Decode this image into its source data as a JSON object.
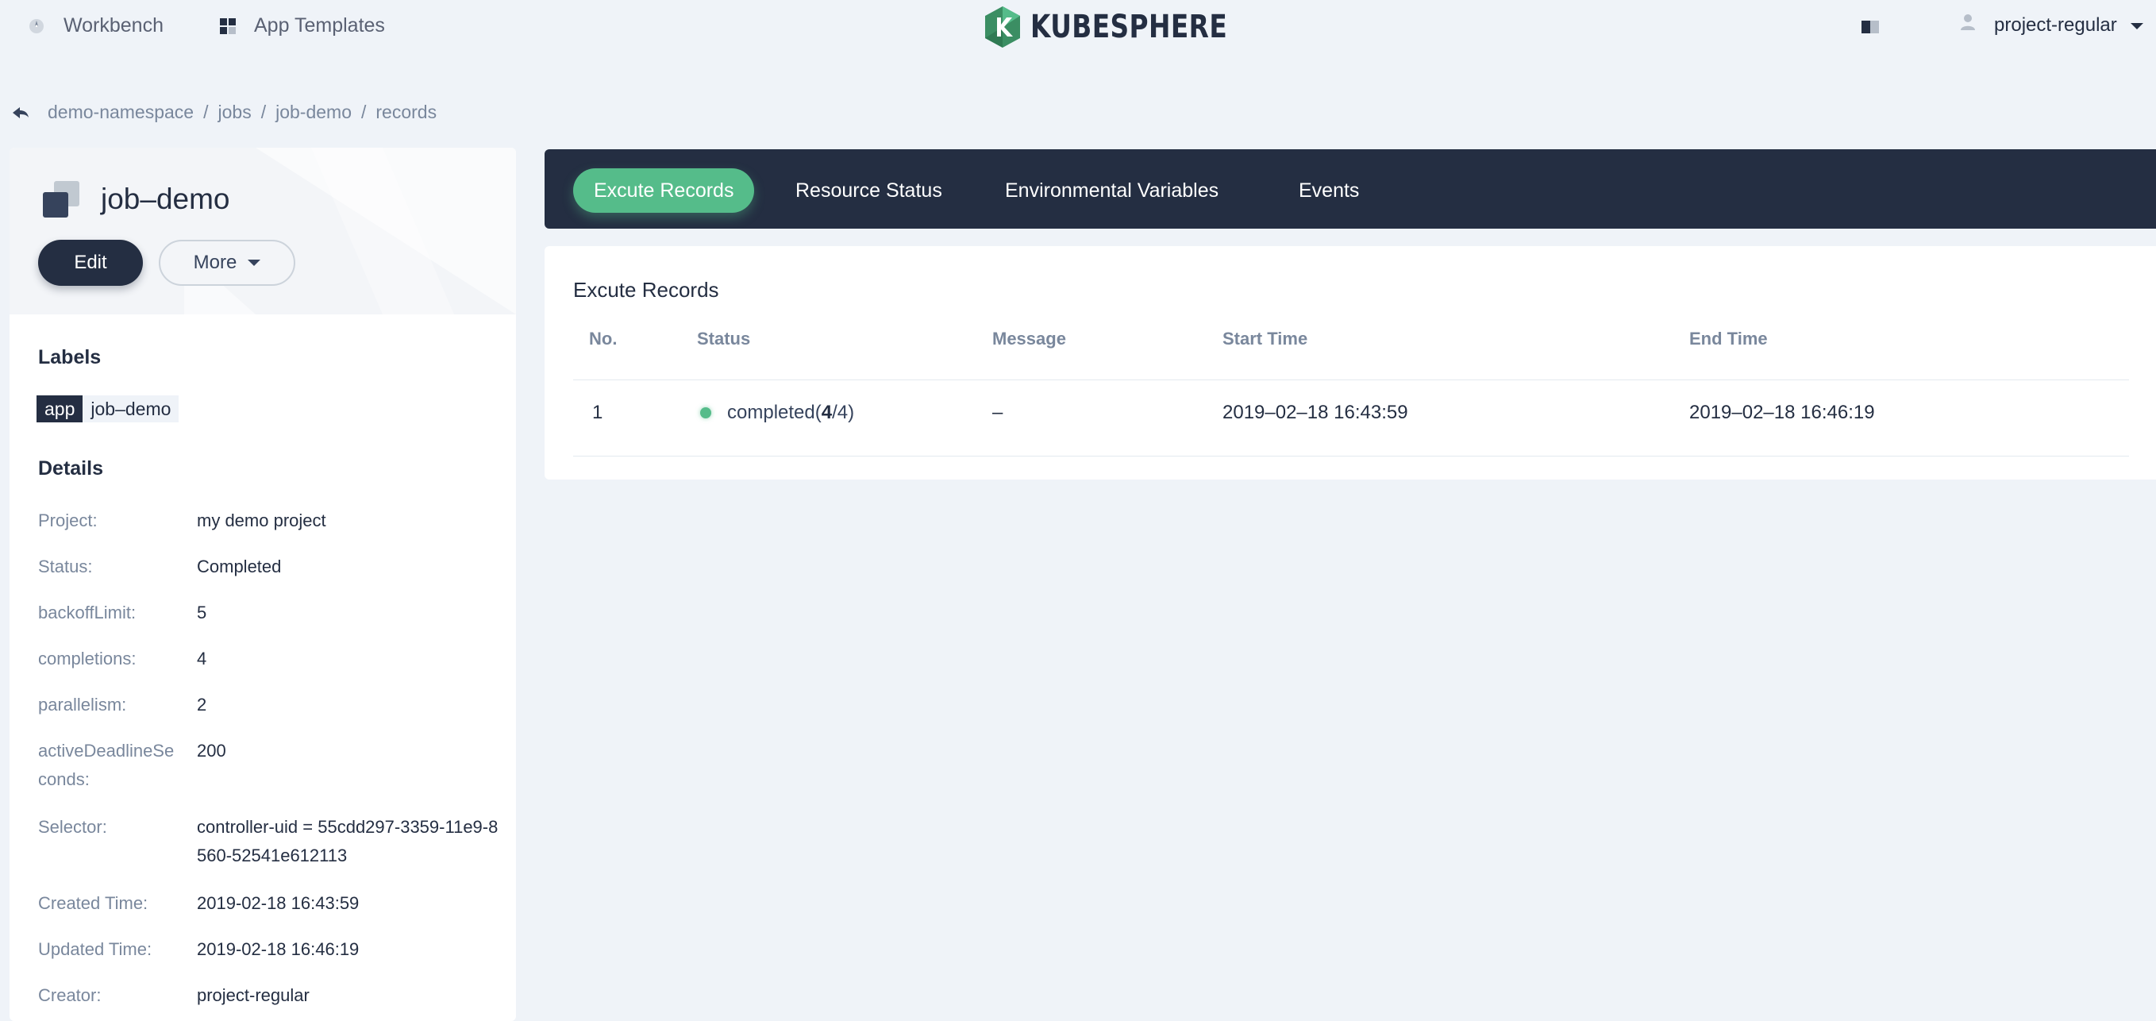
{
  "topbar": {
    "workbench": "Workbench",
    "app_templates": "App Templates",
    "logo": "KUBESPHERE",
    "user": "project-regular"
  },
  "breadcrumb": [
    "demo-namespace",
    "jobs",
    "job-demo",
    "records"
  ],
  "job": {
    "name": "job–demo",
    "edit_label": "Edit",
    "more_label": "More"
  },
  "labels": {
    "title": "Labels",
    "items": [
      {
        "key": "app",
        "value": "job–demo"
      }
    ]
  },
  "details": {
    "title": "Details",
    "rows": [
      {
        "key": "Project:",
        "value": "my demo project"
      },
      {
        "key": "Status:",
        "value": "Completed"
      },
      {
        "key": "backoffLimit:",
        "value": "5"
      },
      {
        "key": "completions:",
        "value": "4"
      },
      {
        "key": "parallelism:",
        "value": "2"
      },
      {
        "key": "activeDeadlineSeconds:",
        "value": "200"
      },
      {
        "key": "Selector:",
        "value": "controller-uid = 55cdd297-3359-11e9-8560-52541e612113"
      },
      {
        "key": "Created Time:",
        "value": "2019-02-18 16:43:59"
      },
      {
        "key": "Updated Time:",
        "value": "2019-02-18 16:46:19"
      },
      {
        "key": "Creator:",
        "value": "project-regular"
      }
    ]
  },
  "tabs": [
    "Excute Records",
    "Resource Status",
    "Environmental Variables",
    "Events"
  ],
  "records": {
    "title": "Excute Records",
    "columns": [
      "No.",
      "Status",
      "Message",
      "Start Time",
      "End Time"
    ],
    "rows": [
      {
        "no": "1",
        "status_prefix": "completed(",
        "status_done": "4",
        "status_suffix": "/4)",
        "message": "–",
        "start": "2019–02–18 16:43:59",
        "end": "2019–02–18 16:46:19"
      }
    ]
  },
  "colors": {
    "primary_dark": "#242e42",
    "success_green": "#55bc8a",
    "background": "#eff3f8",
    "muted_text": "#79879c"
  }
}
